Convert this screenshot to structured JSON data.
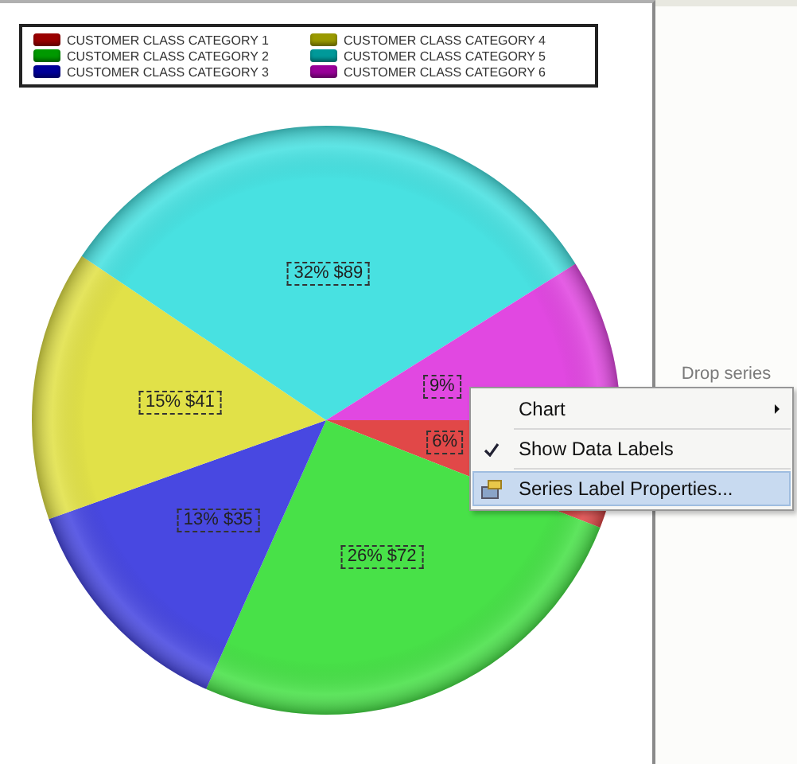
{
  "legend": [
    {
      "label": "CUSTOMER CLASS CATEGORY 1",
      "color": "#990000"
    },
    {
      "label": "CUSTOMER CLASS CATEGORY 2",
      "color": "#009900"
    },
    {
      "label": "CUSTOMER CLASS CATEGORY 3",
      "color": "#000099"
    },
    {
      "label": "CUSTOMER CLASS CATEGORY 4",
      "color": "#999900"
    },
    {
      "label": "CUSTOMER CLASS CATEGORY 5",
      "color": "#009999"
    },
    {
      "label": "CUSTOMER CLASS CATEGORY 6",
      "color": "#990099"
    }
  ],
  "chart_data": {
    "type": "pie",
    "values": [
      6,
      26,
      13,
      15,
      32,
      9
    ],
    "value_labels": [
      "6%",
      "26% $72",
      "13% $35",
      "15% $41",
      "32% $89",
      "9%"
    ]
  },
  "drop_zone": {
    "label": "Drop series"
  },
  "context_menu": [
    {
      "label": "Chart",
      "submenu": true,
      "checked": false,
      "selected": false
    },
    {
      "label": "Show Data Labels",
      "submenu": false,
      "checked": true,
      "selected": false
    },
    {
      "label": "Series Label Properties...",
      "submenu": false,
      "checked": false,
      "selected": true,
      "kind": "icon"
    }
  ]
}
